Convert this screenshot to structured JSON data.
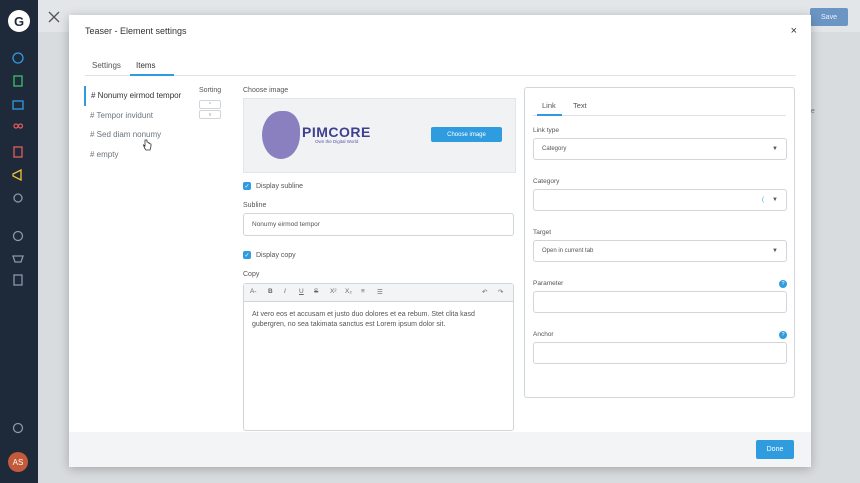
{
  "modal": {
    "title": "Teaser - Element settings",
    "close": "×",
    "tabs": [
      "Settings",
      "Items"
    ],
    "active_tab": "Items"
  },
  "items": [
    {
      "label": "# Nonumy eirmod tempor",
      "active": true
    },
    {
      "label": "# Tempor invidunt",
      "active": false
    },
    {
      "label": "# Sed diam nonumy",
      "active": false
    },
    {
      "label": "# empty",
      "active": false
    }
  ],
  "sorting": {
    "label": "Sorting",
    "up": "^",
    "down": "v"
  },
  "image": {
    "label": "Choose image",
    "brand": "PIMCORE",
    "tagline": "Own the Digital World",
    "button": "Choose image"
  },
  "subline": {
    "checkbox_label": "Display subline",
    "label": "Subline",
    "value": "Nonumy eirmod tempor"
  },
  "copy": {
    "checkbox_label": "Display copy",
    "label": "Copy",
    "text": "At vero eos et accusam et justo duo dolores et ea rebum. Stet clita kasd gubergren, no sea takimata sanctus est Lorem ipsum dolor sit."
  },
  "right_panel": {
    "tabs": [
      "Link",
      "Text"
    ],
    "active_tab": "Link",
    "link_type_label": "Link type",
    "link_type_value": "Category",
    "category_label": "Category",
    "category_value": "",
    "target_label": "Target",
    "target_value": "Open in current tab",
    "parameter_label": "Parameter",
    "anchor_label": "Anchor"
  },
  "footer": {
    "done": "Done"
  },
  "background": {
    "save": "Save",
    "right_text": "ete"
  },
  "user": {
    "initials": "AS"
  },
  "colors": {
    "accent": "#2f9ce0",
    "sidebar": "#1e2a39"
  }
}
